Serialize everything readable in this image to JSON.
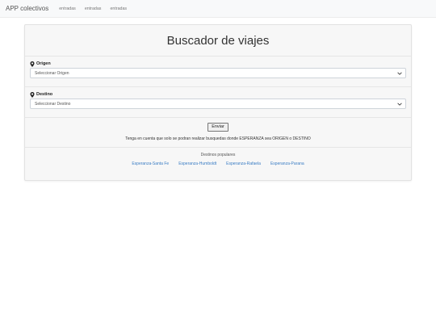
{
  "navbar": {
    "brand": "APP colectivos",
    "links": [
      "entradas",
      "entradas",
      "entradas"
    ]
  },
  "card": {
    "title": "Buscador de viajes",
    "origin": {
      "label": "Origen",
      "selected": "Seleccionar Origen"
    },
    "destination": {
      "label": "Destino",
      "selected": "Seleccionar Destino"
    },
    "submit_label": "Enviar",
    "notice": "Tenga en cuenta que solo se podran realizar busquedas donde ESPERANZA sea ORIGEN o DESTINO",
    "popular_title": "Destinos populares",
    "popular_links": [
      "Esperanza-Santa Fe",
      "Esperanza-Humboldt",
      "Esperanza-Rafaela",
      "Esperanza-Parana"
    ]
  },
  "colors": {
    "link": "#3b7dc4",
    "navbar_bg": "#f8f9fa",
    "card_bg": "#f7f7f7"
  },
  "icons": {
    "field_label": "map-marker-icon",
    "select_arrow": "chevron-down-icon"
  }
}
